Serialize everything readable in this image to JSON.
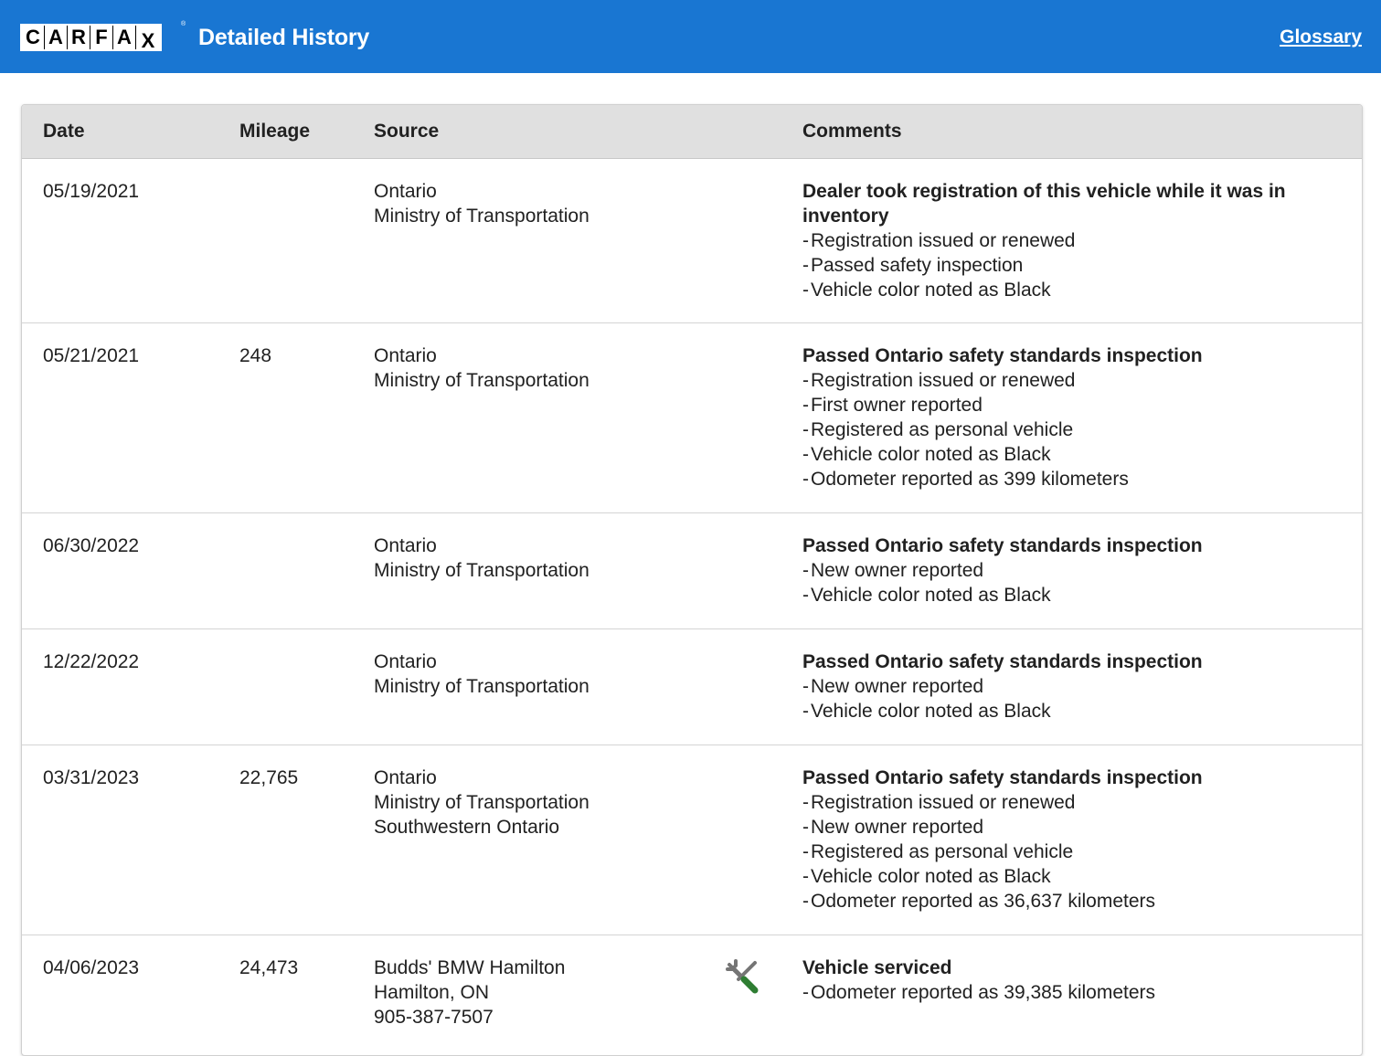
{
  "header": {
    "logo_letters": [
      "C",
      "A",
      "R",
      "F",
      "A",
      "X"
    ],
    "logo_mark": "®",
    "title": "Detailed History",
    "glossary_label": "Glossary"
  },
  "colors": {
    "header_bg": "#1976d2",
    "table_header_bg": "#e0e0e0",
    "service_icon_wrench": "#757575",
    "service_icon_screwdriver": "#2e7d32"
  },
  "table": {
    "columns": {
      "date": "Date",
      "mileage": "Mileage",
      "source": "Source",
      "comments": "Comments"
    },
    "rows": [
      {
        "date": "05/19/2021",
        "mileage": "",
        "source": [
          "Ontario",
          "Ministry of Transportation"
        ],
        "icon": "",
        "comment_title": "Dealer took registration of this vehicle while it was in inventory",
        "comment_items": [
          "Registration issued or renewed",
          "Passed safety inspection",
          "Vehicle color noted as Black"
        ]
      },
      {
        "date": "05/21/2021",
        "mileage": "248",
        "source": [
          "Ontario",
          "Ministry of Transportation"
        ],
        "icon": "",
        "comment_title": "Passed Ontario safety standards inspection",
        "comment_items": [
          "Registration issued or renewed",
          "First owner reported",
          "Registered as personal vehicle",
          "Vehicle color noted as Black",
          "Odometer reported as 399 kilometers"
        ]
      },
      {
        "date": "06/30/2022",
        "mileage": "",
        "source": [
          "Ontario",
          "Ministry of Transportation"
        ],
        "icon": "",
        "comment_title": "Passed Ontario safety standards inspection",
        "comment_items": [
          "New owner reported",
          "Vehicle color noted as Black"
        ]
      },
      {
        "date": "12/22/2022",
        "mileage": "",
        "source": [
          "Ontario",
          "Ministry of Transportation"
        ],
        "icon": "",
        "comment_title": "Passed Ontario safety standards inspection",
        "comment_items": [
          "New owner reported",
          "Vehicle color noted as Black"
        ]
      },
      {
        "date": "03/31/2023",
        "mileage": "22,765",
        "source": [
          "Ontario",
          "Ministry of Transportation",
          "Southwestern Ontario"
        ],
        "icon": "",
        "comment_title": "Passed Ontario safety standards inspection",
        "comment_items": [
          "Registration issued or renewed",
          "New owner reported",
          "Registered as personal vehicle",
          "Vehicle color noted as Black",
          "Odometer reported as 36,637 kilometers"
        ]
      },
      {
        "date": "04/06/2023",
        "mileage": "24,473",
        "source": [
          "Budds' BMW Hamilton",
          "Hamilton, ON",
          "905-387-7507"
        ],
        "icon": "service-tools-icon",
        "comment_title": "Vehicle serviced",
        "comment_items": [
          "Odometer reported as 39,385 kilometers"
        ]
      }
    ]
  }
}
